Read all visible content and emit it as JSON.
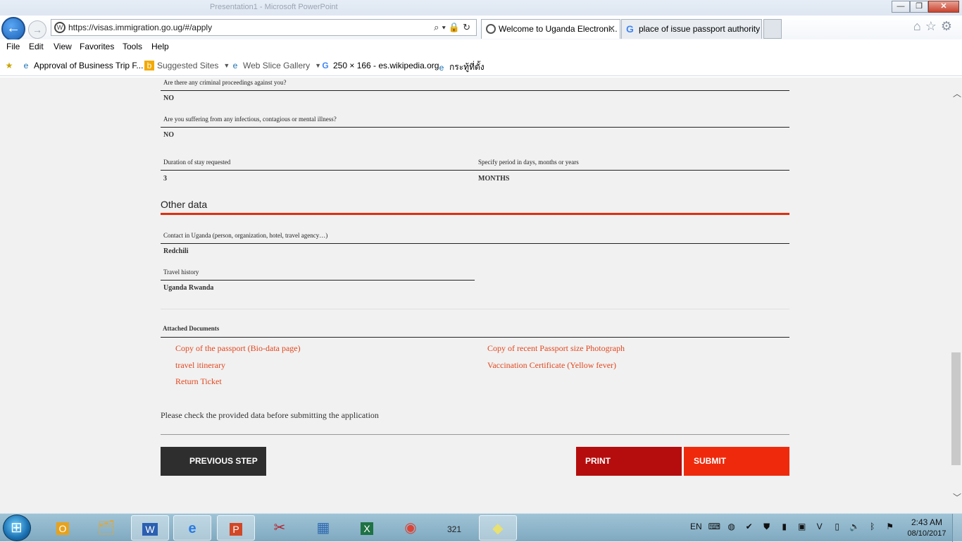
{
  "window": {
    "title": "Presentation1 - Microsoft PowerPoint",
    "min_label": "—",
    "max_label": "❐",
    "close_label": "✕"
  },
  "browser": {
    "url": "https://visas.immigration.go.ug/#/apply",
    "tabs": [
      {
        "label": "Welcome to Uganda Electroni...",
        "active": true
      },
      {
        "label": "place of issue passport authority ...",
        "active": false
      }
    ],
    "menu": [
      "File",
      "Edit",
      "View",
      "Favorites",
      "Tools",
      "Help"
    ],
    "favorites": [
      "Approval of Business Trip F...",
      "Suggested Sites",
      "Web Slice Gallery",
      "250 × 166 - es.wikipedia.org",
      "กระทู้ที่ตั้ง"
    ]
  },
  "form": {
    "criminal": {
      "label": "Are there any criminal proceedings against you?",
      "value": "NO"
    },
    "illness": {
      "label": "Are you suffering from any infectious, contagious or mental illness?",
      "value": "NO"
    },
    "duration": {
      "label": "Duration of stay requested",
      "value": "3"
    },
    "period": {
      "label": "Specify period in days, months or years",
      "value": "MONTHS"
    },
    "other_title": "Other data",
    "contact": {
      "label": "Contact in Uganda (person, organization, hotel, travel agency…)",
      "value": "Redchili"
    },
    "travel": {
      "label": "Travel history",
      "value": "Uganda Rwanda"
    },
    "attached_title": "Attached Documents",
    "documents": [
      "Copy of the passport (Bio-data page)",
      "Copy of recent Passport size Photograph",
      "travel itinerary",
      "Vaccination Certificate (Yellow fever)",
      "Return Ticket"
    ],
    "notice": "Please check the provided data before submitting the application",
    "buttons": {
      "prev": "PREVIOUS STEP",
      "print": "PRINT",
      "submit": "SUBMIT"
    }
  },
  "taskbar": {
    "language": "EN",
    "time": "2:43 AM",
    "date": "08/10/2017"
  },
  "colors": {
    "accent": "#ef2a0c",
    "print": "#b50d0d",
    "prev": "#2e2e2e",
    "link": "#e2461d"
  }
}
